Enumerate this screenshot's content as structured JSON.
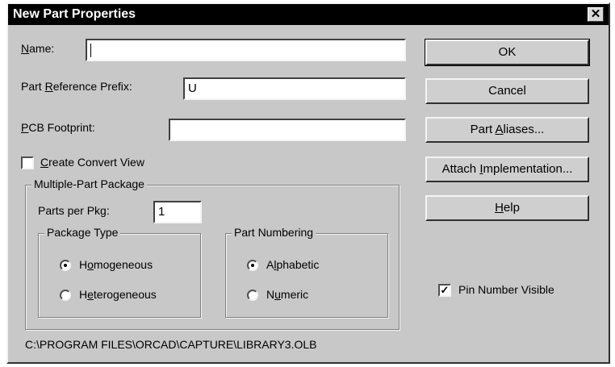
{
  "window": {
    "title": "New Part Properties",
    "close_glyph": "✕"
  },
  "fields": {
    "name": {
      "label_mnemonic": "N",
      "label_rest": "ame:",
      "value": ""
    },
    "prefix": {
      "label_pre": "Part ",
      "label_mnemonic": "R",
      "label_rest": "eference Prefix:",
      "value": "U"
    },
    "footprint": {
      "label_mnemonic": "P",
      "label_rest": "CB Footprint:",
      "value": ""
    }
  },
  "create_convert_view": {
    "label_mnemonic": "C",
    "label_rest": "reate Convert View",
    "checked": false
  },
  "multiple_part_package": {
    "title": "Multiple-Part Package",
    "parts_per_pkg_label_pre": "Parts per Pk",
    "parts_per_pkg_label_mnemonic": "g",
    "parts_per_pkg_label_rest": ":",
    "parts_per_pkg_value": "1",
    "package_type": {
      "title": "Package Type",
      "homogeneous": {
        "pre": "H",
        "mnemonic": "o",
        "rest": "mogeneous",
        "selected": true
      },
      "heterogeneous": {
        "pre": "H",
        "mnemonic": "e",
        "rest": "terogeneous",
        "selected": false
      }
    },
    "part_numbering": {
      "title": "Part Numbering",
      "alphabetic": {
        "pre": "A",
        "mnemonic": "l",
        "rest": "phabetic",
        "selected": true
      },
      "numeric": {
        "pre": "N",
        "mnemonic": "u",
        "rest": "meric",
        "selected": false
      }
    }
  },
  "buttons": {
    "ok": "OK",
    "cancel": "Cancel",
    "part_aliases": {
      "pre": "Part ",
      "mnemonic": "A",
      "rest": "liases..."
    },
    "attach_implementation": {
      "pre": "Attach ",
      "mnemonic": "I",
      "rest": "mplementation..."
    },
    "help": {
      "pre": "",
      "mnemonic": "H",
      "rest": "elp"
    }
  },
  "pin_number_visible": {
    "label": "Pin Number Visible",
    "checked": true,
    "check_glyph": "✓"
  },
  "library_path": "C:\\PROGRAM FILES\\ORCAD\\CAPTURE\\LIBRARY3.OLB"
}
